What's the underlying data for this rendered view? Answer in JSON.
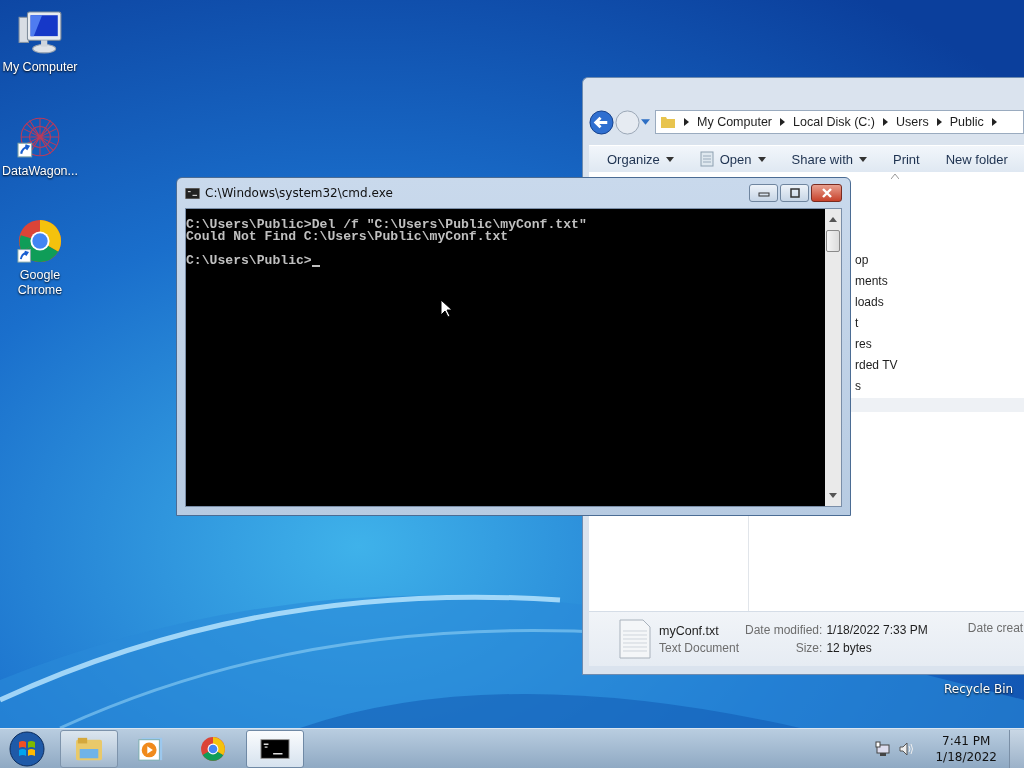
{
  "desktop_icons": [
    {
      "label": "My Computer",
      "kind": "computer",
      "shortcut": false
    },
    {
      "label": "DataWagon...",
      "kind": "datawagon",
      "shortcut": true
    },
    {
      "label": "Google Chrome",
      "kind": "chrome",
      "shortcut": true
    }
  ],
  "recycle_bin": {
    "label": "Recycle Bin"
  },
  "explorer": {
    "breadcrumb": [
      "My Computer",
      "Local Disk (C:)",
      "Users",
      "Public"
    ],
    "toolbar": [
      {
        "label": "Organize",
        "dropdown": true,
        "icon": false
      },
      {
        "label": "Open",
        "dropdown": true,
        "icon": true
      },
      {
        "label": "Share with",
        "dropdown": true,
        "icon": false
      },
      {
        "label": "Print",
        "dropdown": false,
        "icon": false
      },
      {
        "label": "New folder",
        "dropdown": false,
        "icon": false
      }
    ],
    "nav_items": [
      "op",
      "ments",
      "loads",
      "t",
      "res",
      "rded TV",
      "s"
    ],
    "details": {
      "name": "myConf.txt",
      "type": "Text Document",
      "fields": [
        {
          "label": "Date modified:",
          "value": "1/18/2022 7:33 PM"
        },
        {
          "label": "Size:",
          "value": "12 bytes"
        }
      ],
      "cut_label": "Date creat"
    }
  },
  "cmd": {
    "title": "C:\\Windows\\system32\\cmd.exe",
    "lines": [
      "C:\\Users\\Public>Del /f \"C:\\Users\\Public\\myConf.txt\"",
      "Could Not Find C:\\Users\\Public\\myConf.txt"
    ],
    "prompt": "C:\\Users\\Public>"
  },
  "taskbar": {
    "items": [
      {
        "kind": "explorer",
        "open": true,
        "selected": false
      },
      {
        "kind": "media",
        "open": false,
        "selected": false
      },
      {
        "kind": "chrome",
        "open": false,
        "selected": false
      },
      {
        "kind": "cmd",
        "open": true,
        "selected": true
      }
    ],
    "clock": {
      "time": "7:41 PM",
      "date": "1/18/2022"
    }
  }
}
